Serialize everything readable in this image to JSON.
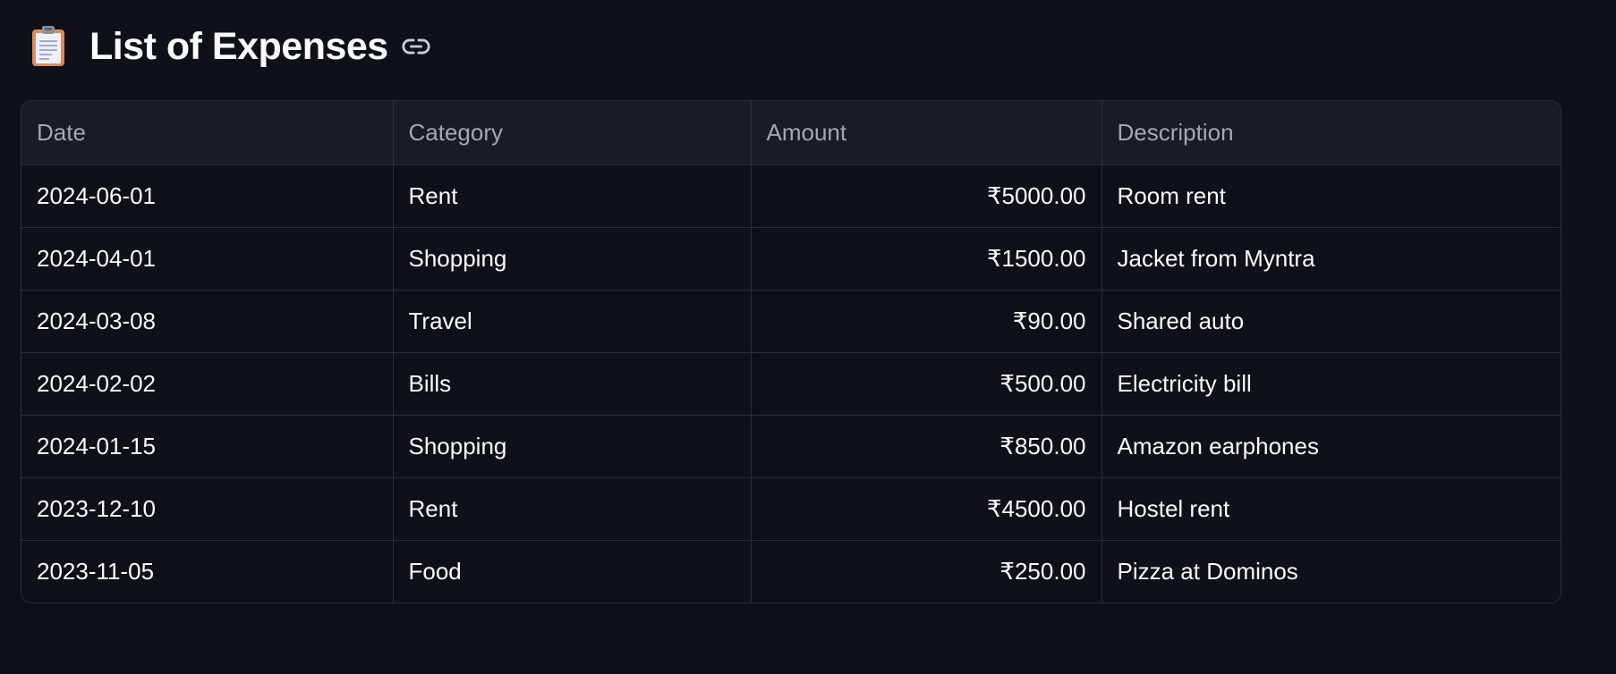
{
  "header": {
    "icon": "clipboard-icon",
    "title": "List of Expenses",
    "anchor_icon": "link-icon"
  },
  "table": {
    "columns": [
      "Date",
      "Category",
      "Amount",
      "Description"
    ],
    "rows": [
      {
        "date": "2024-06-01",
        "category": "Rent",
        "amount": "₹5000.00",
        "description": "Room rent"
      },
      {
        "date": "2024-04-01",
        "category": "Shopping",
        "amount": "₹1500.00",
        "description": "Jacket from Myntra"
      },
      {
        "date": "2024-03-08",
        "category": "Travel",
        "amount": "₹90.00",
        "description": "Shared auto"
      },
      {
        "date": "2024-02-02",
        "category": "Bills",
        "amount": "₹500.00",
        "description": "Electricity bill"
      },
      {
        "date": "2024-01-15",
        "category": "Shopping",
        "amount": "₹850.00",
        "description": "Amazon earphones"
      },
      {
        "date": "2023-12-10",
        "category": "Rent",
        "amount": "₹4500.00",
        "description": "Hostel rent"
      },
      {
        "date": "2023-11-05",
        "category": "Food",
        "amount": "₹250.00",
        "description": "Pizza at Dominos"
      }
    ]
  },
  "colors": {
    "background": "#0e1117",
    "header_row": "#1a1c24",
    "border": "#2b2f38",
    "text": "#fafafa",
    "header_text": "#a3a8b4"
  }
}
